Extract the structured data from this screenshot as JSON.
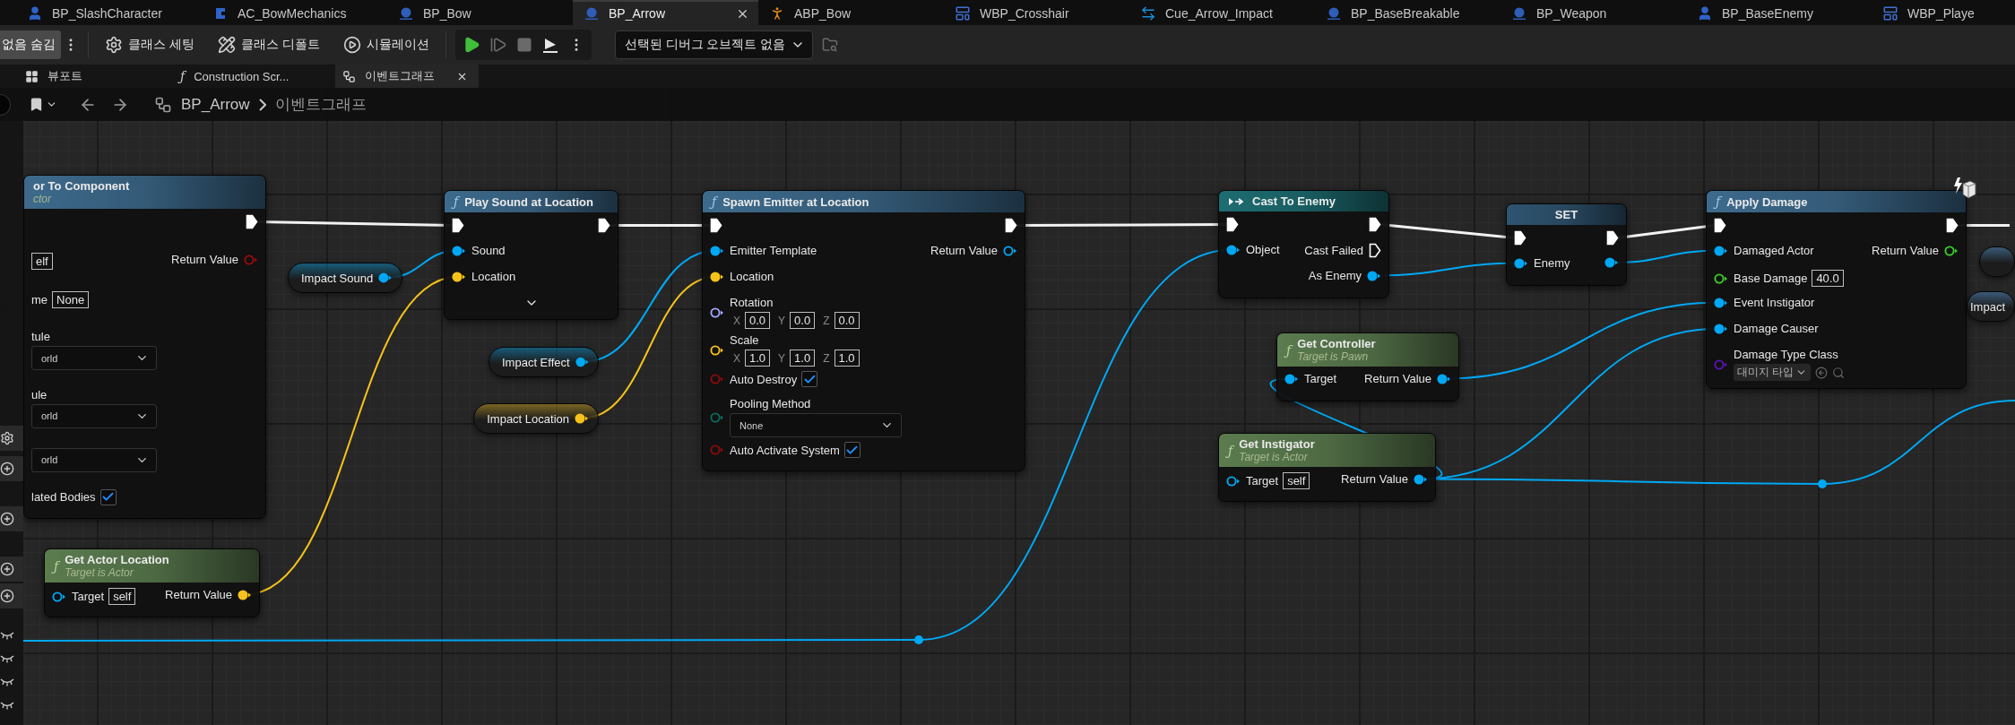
{
  "tabs": [
    {
      "label": "BP_SlashCharacter",
      "kind": "character",
      "selected": false
    },
    {
      "label": "AC_BowMechanics",
      "kind": "component",
      "selected": false
    },
    {
      "label": "BP_Bow",
      "kind": "actor",
      "selected": false
    },
    {
      "label": "BP_Arrow",
      "kind": "actor",
      "selected": true
    },
    {
      "label": "ABP_Bow",
      "kind": "animation",
      "selected": false
    },
    {
      "label": "WBP_Crosshair",
      "kind": "widget",
      "selected": false
    },
    {
      "label": "Cue_Arrow_Impact",
      "kind": "cue",
      "selected": false
    },
    {
      "label": "BP_BaseBreakable",
      "kind": "actor",
      "selected": false
    },
    {
      "label": "BP_Weapon",
      "kind": "actor",
      "selected": false
    },
    {
      "label": "BP_BaseEnemy",
      "kind": "character",
      "selected": false
    },
    {
      "label": "WBP_Playe",
      "kind": "widget",
      "selected": false
    }
  ],
  "toolbar": {
    "hide_button": "없음 숨김",
    "buttons": [
      {
        "kind": "settings",
        "label": "클래스 세팅"
      },
      {
        "kind": "defaults",
        "label": "클래스 디폴트"
      },
      {
        "kind": "simulation",
        "label": "시뮬레이션"
      }
    ],
    "play_controls": [
      {
        "kind": "play",
        "disabled": false
      },
      {
        "kind": "step",
        "disabled": true
      },
      {
        "kind": "stop",
        "disabled": true
      },
      {
        "kind": "possess",
        "disabled": false
      }
    ],
    "debug_object": "선택된 디버그 오브젝트 없음"
  },
  "sub_tabs": [
    {
      "label": "뷰포트",
      "kind": "viewport",
      "selected": false
    },
    {
      "label": "Construction Scr...",
      "kind": "function",
      "glyph": "ƒ",
      "selected": false
    },
    {
      "label": "이벤트그래프",
      "kind": "graph",
      "selected": true
    }
  ],
  "breadcrumb": [
    "BP_Arrow",
    "이벤트그래프"
  ],
  "nodes": [
    {
      "kind": "function",
      "color": "#3d6a8c",
      "title": "or To Component",
      "subtitle": "ctor",
      "rows": [
        {
          "right": {
            "kind": "exec",
            "connected": true
          }
        },
        {
          "left": {
            "kind": "bare",
            "field": "elf"
          },
          "right": {
            "kind": "data",
            "label": "Return Value",
            "color": "#9a0c0c",
            "connected": false
          }
        },
        {
          "left": {
            "kind": "bare",
            "label": "me",
            "field": "None"
          }
        },
        {
          "left": {
            "kind": "bare",
            "label": "tule",
            "dropdown": "orld"
          }
        },
        {
          "left": {
            "kind": "bare",
            "label": "ule",
            "dropdown": "orld"
          }
        },
        {
          "left": {
            "kind": "bare",
            "dropdown": "orld"
          }
        },
        {
          "left": {
            "kind": "bare",
            "label": "lated Bodies",
            "checked": true
          }
        }
      ]
    },
    {
      "kind": "function",
      "color": "#3d6a8c",
      "glyph": "ƒ",
      "title": "Play Sound at Location",
      "advanced": true,
      "rows": [
        {
          "left": {
            "kind": "exec",
            "connected": true
          },
          "right": {
            "kind": "exec",
            "connected": true
          }
        },
        {
          "left": {
            "kind": "data",
            "label": "Sound",
            "color": "#00a8f4",
            "connected": true
          }
        },
        {
          "left": {
            "kind": "data",
            "label": "Location",
            "color": "#f7c31b",
            "connected": true
          }
        }
      ]
    },
    {
      "kind": "function",
      "color": "#3d6a8c",
      "glyph": "ƒ",
      "title": "Spawn Emitter at Location",
      "rows": [
        {
          "left": {
            "kind": "exec",
            "connected": true
          },
          "right": {
            "kind": "exec",
            "connected": true
          }
        },
        {
          "left": {
            "kind": "data",
            "label": "Emitter Template",
            "color": "#00a8f4",
            "connected": true
          },
          "right": {
            "kind": "data",
            "label": "Return Value",
            "color": "#00a8f4",
            "connected": false
          }
        },
        {
          "left": {
            "kind": "data",
            "label": "Location",
            "color": "#f7c31b",
            "connected": true
          }
        },
        {
          "left": {
            "kind": "data",
            "label": "Rotation",
            "color": "#a3a8ff",
            "connected": false,
            "vector": [
              {
                "axis": "X",
                "value": "0.0"
              },
              {
                "axis": "Y",
                "value": "0.0"
              },
              {
                "axis": "Z",
                "value": "0.0"
              }
            ]
          }
        },
        {
          "left": {
            "kind": "data",
            "label": "Scale",
            "color": "#f7c31b",
            "connected": false,
            "vector": [
              {
                "axis": "X",
                "value": "1.0"
              },
              {
                "axis": "Y",
                "value": "1.0"
              },
              {
                "axis": "Z",
                "value": "1.0"
              }
            ]
          }
        },
        {
          "left": {
            "kind": "data",
            "label": "Auto Destroy",
            "color": "#8c0b0b",
            "connected": false,
            "checked": true
          }
        },
        {
          "left": {
            "kind": "data",
            "label": "Pooling Method",
            "color": "#0e6a5e",
            "connected": false,
            "dropdown": "None"
          }
        },
        {
          "left": {
            "kind": "data",
            "label": "Auto Activate System",
            "color": "#8c0b0b",
            "connected": false,
            "checked": true
          }
        }
      ]
    },
    {
      "kind": "cast",
      "color": "#1d6d72",
      "title": "Cast To Enemy",
      "rows": [
        {
          "left": {
            "kind": "exec",
            "connected": true
          },
          "right": {
            "kind": "exec",
            "connected": true
          }
        },
        {
          "left": {
            "kind": "data",
            "label": "Object",
            "color": "#00a8f4",
            "connected": true
          },
          "right": {
            "kind": "exec",
            "label": "Cast Failed",
            "connected": false
          }
        },
        {
          "right": {
            "kind": "data",
            "label": "As Enemy",
            "color": "#00a8f4",
            "connected": true
          }
        }
      ]
    },
    {
      "kind": "set",
      "color": "#2f5470",
      "title": "SET",
      "rows": [
        {
          "left": {
            "kind": "exec",
            "connected": true
          },
          "right": {
            "kind": "exec",
            "connected": true
          }
        },
        {
          "left": {
            "kind": "data",
            "label": "Enemy",
            "color": "#00a8f4",
            "connected": true
          },
          "right": {
            "kind": "data",
            "color": "#00a8f4",
            "connected": true
          }
        }
      ]
    },
    {
      "kind": "function",
      "color": "#3d6a8c",
      "glyph": "ƒ",
      "title": "Apply Damage",
      "server_only": true,
      "rows": [
        {
          "left": {
            "kind": "exec",
            "connected": true
          },
          "right": {
            "kind": "exec",
            "connected": true
          }
        },
        {
          "left": {
            "kind": "data",
            "label": "Damaged Actor",
            "color": "#00a8f4",
            "connected": true
          },
          "right": {
            "kind": "data",
            "label": "Return Value",
            "color": "#3ad12a",
            "connected": false
          }
        },
        {
          "left": {
            "kind": "data",
            "label": "Base Damage",
            "color": "#3ad12a",
            "connected": false,
            "field": "40.0"
          }
        },
        {
          "left": {
            "kind": "data",
            "label": "Event Instigator",
            "color": "#00a8f4",
            "connected": true
          }
        },
        {
          "left": {
            "kind": "data",
            "label": "Damage Causer",
            "color": "#00a8f4",
            "connected": true
          }
        },
        {
          "left": {
            "kind": "data",
            "label": "Damage Type Class",
            "color": "#5a14b4",
            "connected": false,
            "class_picker": "대미지 타입"
          }
        }
      ]
    },
    {
      "kind": "pure",
      "color": "#5b7c4f",
      "glyph": "ƒ",
      "title": "Get Controller",
      "subtitle": "Target is Pawn",
      "rows": [
        {
          "left": {
            "kind": "data",
            "label": "Target",
            "color": "#00a8f4",
            "connected": true
          },
          "right": {
            "kind": "data",
            "label": "Return Value",
            "color": "#00a8f4",
            "connected": true
          }
        }
      ]
    },
    {
      "kind": "pure",
      "color": "#5b7c4f",
      "glyph": "ƒ",
      "title": "Get Instigator",
      "subtitle": "Target is Actor",
      "rows": [
        {
          "left": {
            "kind": "data",
            "label": "Target",
            "color": "#00a8f4",
            "connected": false,
            "field": "self"
          },
          "right": {
            "kind": "data",
            "label": "Return Value",
            "color": "#00a8f4",
            "connected": true
          }
        }
      ]
    },
    {
      "kind": "pure",
      "color": "#5b7c4f",
      "glyph": "ƒ",
      "title": "Get Actor Location",
      "subtitle": "Target is Actor",
      "rows": [
        {
          "left": {
            "kind": "data",
            "label": "Target",
            "color": "#00a8f4",
            "connected": false,
            "field": "self"
          },
          "right": {
            "kind": "data",
            "label": "Return Value",
            "color": "#f7c31b",
            "connected": true
          }
        }
      ]
    },
    {
      "kind": "variable",
      "label": "Impact Sound",
      "pin": {
        "kind": "data",
        "color": "#00a8f4",
        "connected": true
      }
    },
    {
      "kind": "variable",
      "label": "Impact Effect",
      "pin": {
        "kind": "data",
        "color": "#00a8f4",
        "connected": true
      }
    },
    {
      "kind": "variable",
      "label": "Impact Location",
      "pin": {
        "kind": "data",
        "color": "#f7c31b",
        "connected": true
      }
    },
    {
      "kind": "variable"
    },
    {
      "kind": "variable",
      "label": "Impact"
    }
  ]
}
